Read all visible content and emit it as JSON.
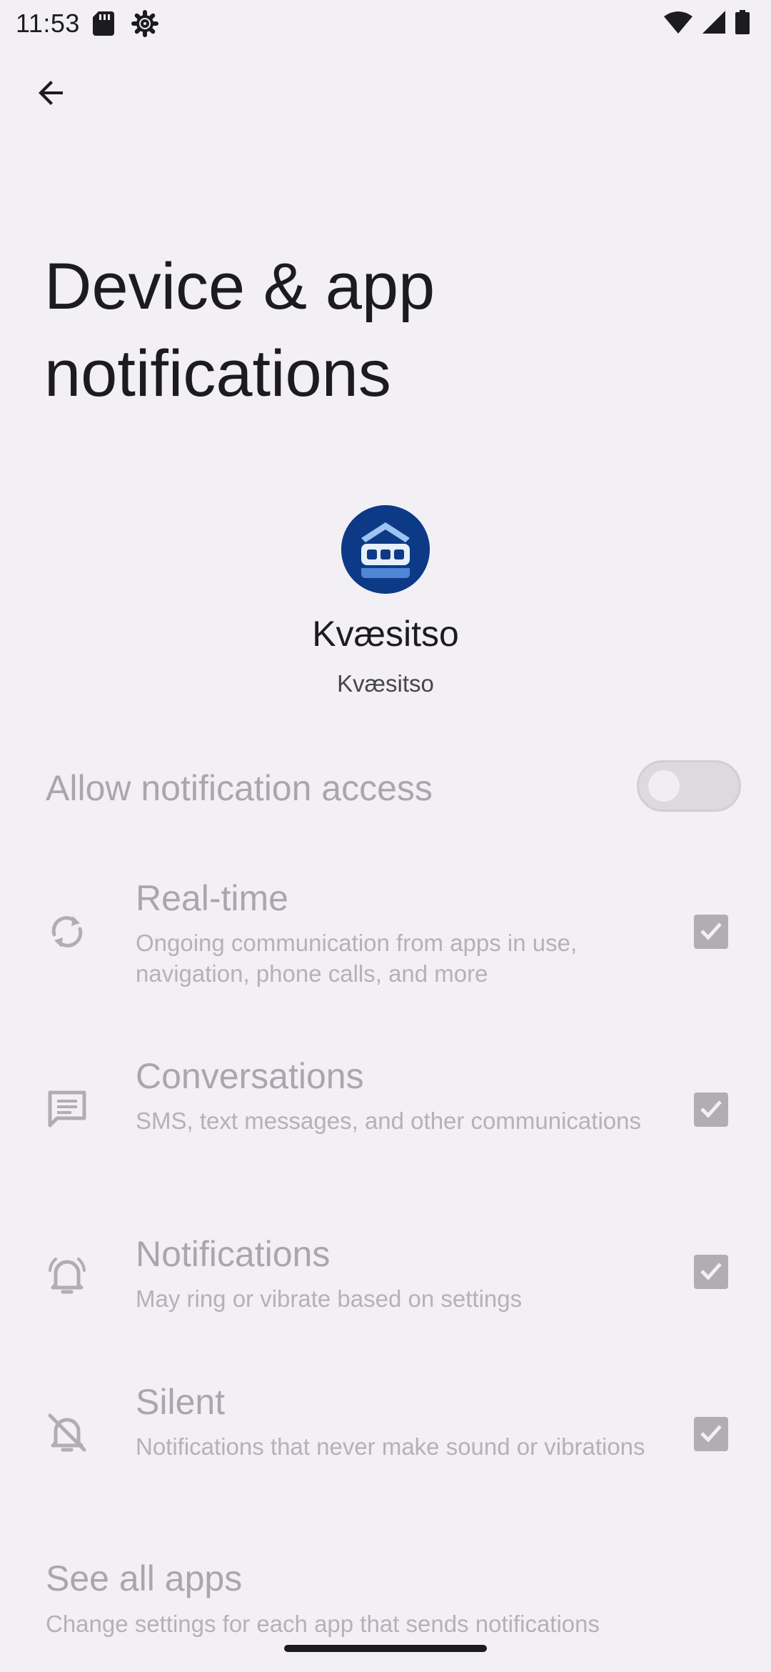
{
  "status_bar": {
    "time": "11:53",
    "icons": [
      "sd-card-icon",
      "settings-gear-icon",
      "wifi-icon",
      "cell-signal-icon",
      "battery-icon"
    ]
  },
  "app_bar": {
    "back_icon": "arrow-back-icon"
  },
  "page": {
    "title": "Device & app notifications"
  },
  "app": {
    "name": "Kvæsitso",
    "package_label": "Kvæsitso",
    "icon_color": "#0d3a86"
  },
  "allow_access": {
    "label": "Allow notification access",
    "enabled": false
  },
  "notification_types": [
    {
      "title": "Real-time",
      "summary": "Ongoing communication from apps in use, navigation, phone calls, and more",
      "icon": "sync-icon",
      "checked": true
    },
    {
      "title": "Conversations",
      "summary": "SMS, text messages, and other communications",
      "icon": "message-icon",
      "checked": true
    },
    {
      "title": "Notifications",
      "summary": "May ring or vibrate based on settings",
      "icon": "bell-ring-icon",
      "checked": true
    },
    {
      "title": "Silent",
      "summary": "Notifications that never make sound or vibrations",
      "icon": "bell-off-icon",
      "checked": true
    }
  ],
  "see_all": {
    "title": "See all apps",
    "summary": "Change settings for each app that sends notifications"
  },
  "colors": {
    "background": "#f2eff5",
    "disabled_text": "#a9a6ad",
    "checkbox_disabled": "#b0adb3"
  }
}
